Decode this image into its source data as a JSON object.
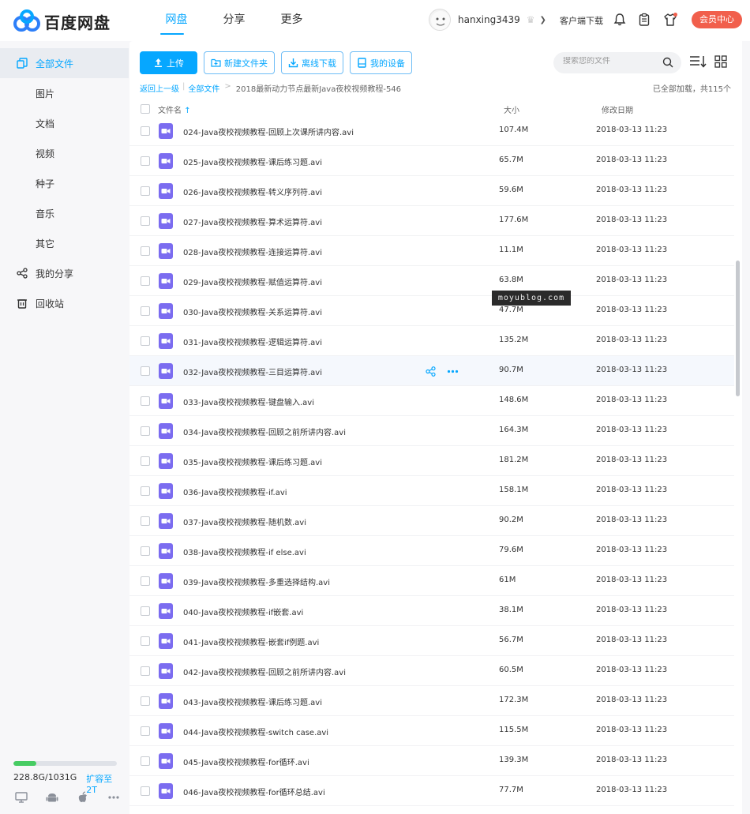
{
  "header": {
    "logo_text": "百度网盘",
    "nav": [
      "网盘",
      "分享",
      "更多"
    ],
    "username": "hanxing3439",
    "client_download": "客户端下载",
    "vip_button": "会员中心"
  },
  "sidebar": {
    "items": [
      {
        "label": "全部文件",
        "active": true
      },
      {
        "label": "图片"
      },
      {
        "label": "文档"
      },
      {
        "label": "视频"
      },
      {
        "label": "种子"
      },
      {
        "label": "音乐"
      },
      {
        "label": "其它"
      },
      {
        "label": "我的分享"
      },
      {
        "label": "回收站"
      }
    ],
    "quota": {
      "used_text": "228.8G/1031G",
      "expand_label": "扩容至2T",
      "used_fraction": 0.22
    }
  },
  "toolbar": {
    "upload": "上传",
    "new_folder": "新建文件夹",
    "offline_download": "离线下载",
    "my_devices": "我的设备"
  },
  "search": {
    "placeholder": "搜索您的文件"
  },
  "breadcrumb": {
    "back": "返回上一级",
    "root": "全部文件",
    "current": "2018最新动力节点最新Java夜校视频教程-546"
  },
  "loaded_status": "已全部加载，共115个",
  "table": {
    "headers": {
      "name": "文件名",
      "size": "大小",
      "date": "修改日期"
    },
    "rows": [
      {
        "name": "024-Java夜校视频教程-回顾上次课所讲内容.avi",
        "size": "107.4M",
        "date": "2018-03-13 11:23"
      },
      {
        "name": "025-Java夜校视频教程-课后练习题.avi",
        "size": "65.7M",
        "date": "2018-03-13 11:23"
      },
      {
        "name": "026-Java夜校视频教程-转义序列符.avi",
        "size": "59.6M",
        "date": "2018-03-13 11:23"
      },
      {
        "name": "027-Java夜校视频教程-算术运算符.avi",
        "size": "177.6M",
        "date": "2018-03-13 11:23"
      },
      {
        "name": "028-Java夜校视频教程-连接运算符.avi",
        "size": "11.1M",
        "date": "2018-03-13 11:23"
      },
      {
        "name": "029-Java夜校视频教程-赋值运算符.avi",
        "size": "63.8M",
        "date": "2018-03-13 11:23"
      },
      {
        "name": "030-Java夜校视频教程-关系运算符.avi",
        "size": "47.7M",
        "date": "2018-03-13 11:23"
      },
      {
        "name": "031-Java夜校视频教程-逻辑运算符.avi",
        "size": "135.2M",
        "date": "2018-03-13 11:23"
      },
      {
        "name": "032-Java夜校视频教程-三目运算符.avi",
        "size": "90.7M",
        "date": "2018-03-13 11:23",
        "hover": true
      },
      {
        "name": "033-Java夜校视频教程-键盘输入.avi",
        "size": "148.6M",
        "date": "2018-03-13 11:23"
      },
      {
        "name": "034-Java夜校视频教程-回顾之前所讲内容.avi",
        "size": "164.3M",
        "date": "2018-03-13 11:23"
      },
      {
        "name": "035-Java夜校视频教程-课后练习题.avi",
        "size": "181.2M",
        "date": "2018-03-13 11:23"
      },
      {
        "name": "036-Java夜校视频教程-if.avi",
        "size": "158.1M",
        "date": "2018-03-13 11:23"
      },
      {
        "name": "037-Java夜校视频教程-随机数.avi",
        "size": "90.2M",
        "date": "2018-03-13 11:23"
      },
      {
        "name": "038-Java夜校视频教程-if else.avi",
        "size": "79.6M",
        "date": "2018-03-13 11:23"
      },
      {
        "name": "039-Java夜校视频教程-多重选择结构.avi",
        "size": "61M",
        "date": "2018-03-13 11:23"
      },
      {
        "name": "040-Java夜校视频教程-if嵌套.avi",
        "size": "38.1M",
        "date": "2018-03-13 11:23"
      },
      {
        "name": "041-Java夜校视频教程-嵌套if例题.avi",
        "size": "56.7M",
        "date": "2018-03-13 11:23"
      },
      {
        "name": "042-Java夜校视频教程-回顾之前所讲内容.avi",
        "size": "60.5M",
        "date": "2018-03-13 11:23"
      },
      {
        "name": "043-Java夜校视频教程-课后练习题.avi",
        "size": "172.3M",
        "date": "2018-03-13 11:23"
      },
      {
        "name": "044-Java夜校视频教程-switch case.avi",
        "size": "115.5M",
        "date": "2018-03-13 11:23"
      },
      {
        "name": "045-Java夜校视频教程-for循环.avi",
        "size": "139.3M",
        "date": "2018-03-13 11:23"
      },
      {
        "name": "046-Java夜校视频教程-for循环总结.avi",
        "size": "77.7M",
        "date": "2018-03-13 11:23"
      }
    ]
  },
  "watermark": "moyublog.com",
  "colors": {
    "accent": "#06a7ff",
    "vip": "#f15f4c",
    "quota_fill": "#47cc63",
    "video_icon": "#7b6cf0"
  }
}
